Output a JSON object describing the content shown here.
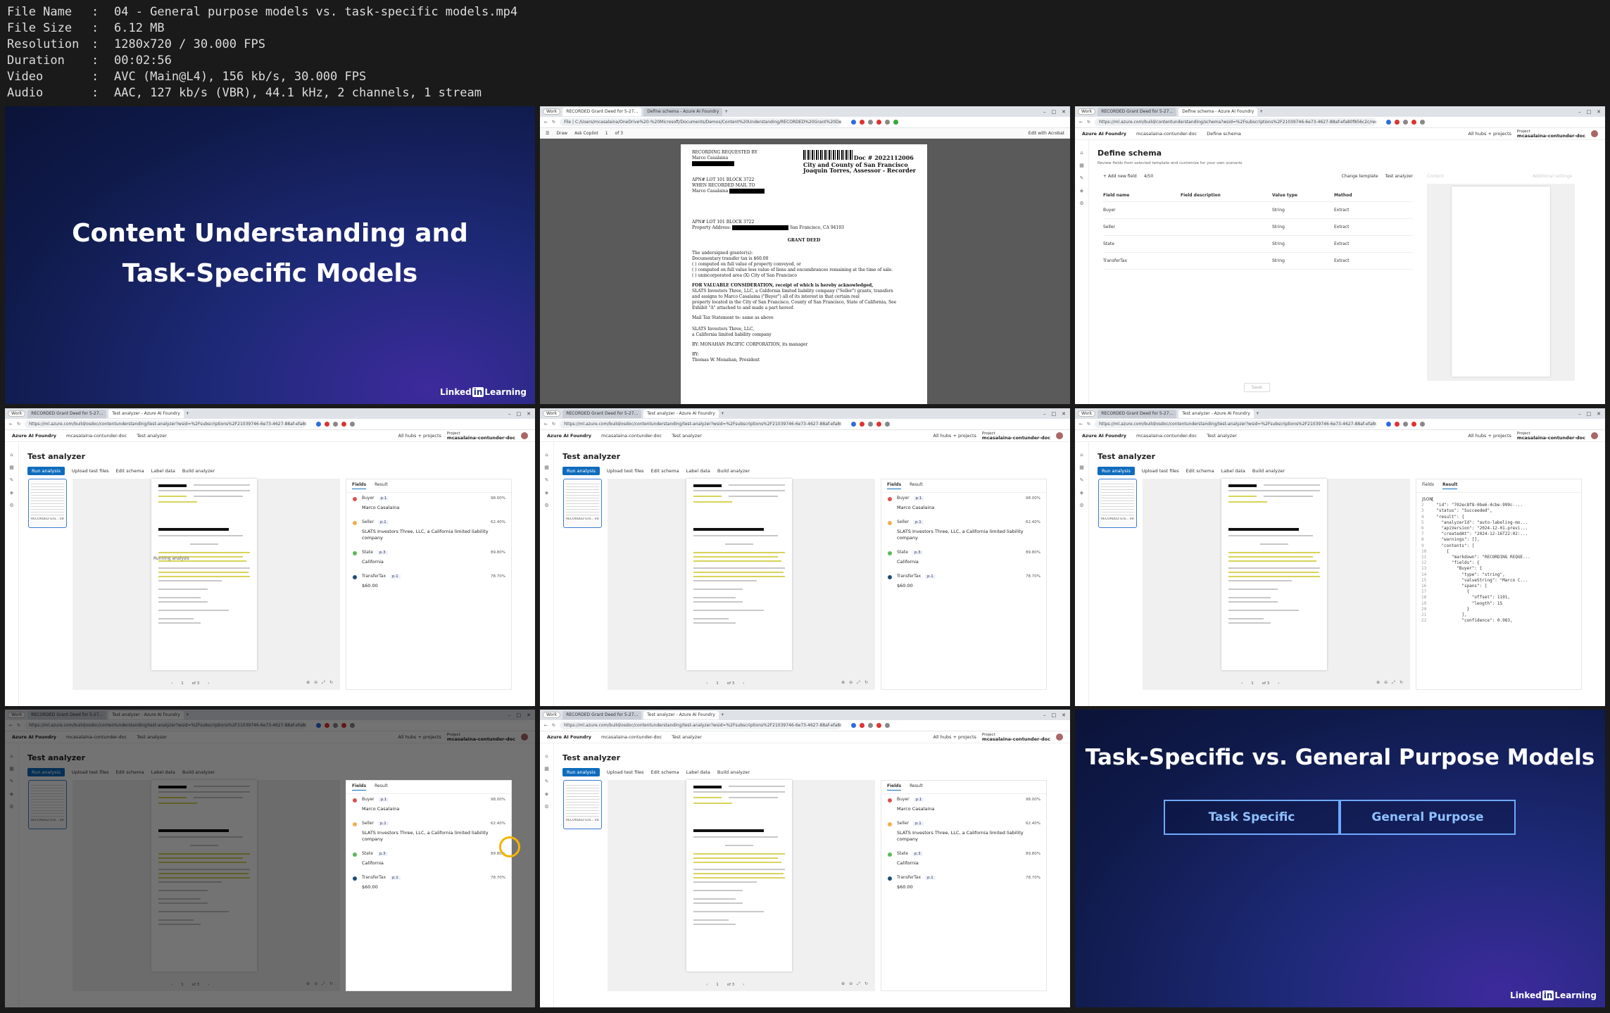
{
  "meta": [
    {
      "key": "File Name",
      "value": "04 - General purpose models vs. task-specific models.mp4"
    },
    {
      "key": "File Size",
      "value": "6.12 MB"
    },
    {
      "key": "Resolution",
      "value": "1280x720 / 30.000 FPS"
    },
    {
      "key": "Duration",
      "value": "00:02:56"
    },
    {
      "key": "Video",
      "value": "AVC (Main@L4), 156 kb/s, 30.000 FPS"
    },
    {
      "key": "Audio",
      "value": "AAC, 127 kb/s (VBR), 44.1 kHz, 2 channels, 1 stream"
    }
  ],
  "slide1": {
    "line1": "Content Understanding and",
    "line2": "Task-Specific Models",
    "logo_a": "Linked",
    "logo_b": "in",
    "logo_c": "Learning"
  },
  "slide9": {
    "title": "Task-Specific vs. General Purpose Models",
    "box1": "Task Specific",
    "box2": "General Purpose",
    "logo_a": "Linked",
    "logo_b": "in",
    "logo_c": "Learning"
  },
  "browser": {
    "work": "Work",
    "tab_pdf": "RECORDED Grant Deed for 5-27...",
    "tab_schema": "Define schema - Azure AI Foundry",
    "tab_test": "Test analyzer - Azure AI Foundry",
    "url_app": "https://ml.azure.com/build/osdoc/contentunderstanding/test-analyzer?wsid=%2Fsubscriptions%2F21039746-6e73-4627-88af-efa80f856c2c%...",
    "url_schema": "https://ml.azure.com/build/contentunderstanding/schema?wsid=%2Fsubscriptions%2F21039746-6e73-4627-88af-efa80f856c2c/resourceGro...",
    "url_file": "File | C:/Users/mcasalaina/OneDrive%20-%20Microsoft/Documents/Demos/Content%20Understanding/RECORDED%20Grant%20Deed..."
  },
  "app": {
    "brand": "Azure AI Foundry",
    "crumb_project": "mcasalaina-contunder-doc",
    "crumb_test": "Test analyzer",
    "crumb_schema": "Define schema",
    "all_hubs": "All hubs + projects",
    "project_label": "Project",
    "project_name": "mcasalaina-contunder-doc",
    "test_title": "Test analyzer",
    "btn_run": "Run analysis",
    "btn_upload": "Upload test files",
    "btn_edit": "Edit schema",
    "btn_label": "Label data",
    "btn_build": "Build analyzer",
    "thumb_label": "RECORDED Gra... ed.pdf",
    "tab_fields": "Fields",
    "tab_result": "Result",
    "page_of": "of 3",
    "page_num": "1",
    "running": "Running analysis",
    "json_label": "JSON"
  },
  "fields": [
    {
      "name": "Buyer",
      "page": "p.1",
      "conf": "98.00%",
      "value": "Marco Casalaina",
      "color": "#d9534f"
    },
    {
      "name": "Seller",
      "page": "p.1",
      "conf": "62.40%",
      "value": "SLATS Investors Three, LLC, a California limited liability company",
      "color": "#f0ad4e"
    },
    {
      "name": "State",
      "page": "p.3",
      "conf": "89.80%",
      "value": "California",
      "color": "#5cb85c"
    },
    {
      "name": "TransferTax",
      "page": "p.1",
      "conf": "78.70%",
      "value": "$60.00",
      "color": "#1f4e79"
    }
  ],
  "schema": {
    "title": "Define schema",
    "subtitle": "Review fields from selected template and customize for your own scenario",
    "add_field": "+ Add new field",
    "count": "4/50",
    "change_template": "Change template",
    "test_analyzer": "Test analyzer",
    "content": "Content",
    "additional": "Additional settings",
    "col_name": "Field name",
    "col_desc": "Field description",
    "col_type": "Value type",
    "col_method": "Method",
    "rows": [
      {
        "name": "Buyer",
        "type": "String",
        "method": "Extract"
      },
      {
        "name": "Seller",
        "type": "String",
        "method": "Extract"
      },
      {
        "name": "State",
        "type": "String",
        "method": "Extract"
      },
      {
        "name": "TransferTax",
        "type": "String",
        "method": "Extract"
      }
    ],
    "save": "Save"
  },
  "pdf": {
    "draw": "Draw",
    "ask": "Ask Copilot",
    "page": "1",
    "of": "of 3",
    "edit_acrobat": "Edit with Acrobat",
    "recording": "RECORDING REQUESTED BY",
    "name": "Marco Casalaina",
    "doc_no": "Doc # 2022112006",
    "county": "City and County of San Francisco",
    "assessor": "Joaquin Torres, Assessor - Recorder",
    "apn": "APN# LOT 101 BLOCK 3722",
    "when": "WHEN RECORDED MAIL TO",
    "apn2": "APN# LOT 101 BLOCK 3722",
    "property": "Property Address:",
    "city": "San Francisco, CA 94103",
    "heading": "GRANT DEED",
    "grantor": "The undersigned grantor(s):",
    "transfer": "Documentary transfer tax is $60.00",
    "l1": "( ) computed on full value of property conveyed, or",
    "l2": "( ) computed on full value less value of liens and encumbrances remaining at the time of sale.",
    "l3": "( ) unincorporated area     (X) City of San Francisco",
    "valuable": "FOR VALUABLE CONSIDERATION, receipt of which is hereby acknowledged,",
    "v1": "SLATS Investors Three, LLC, a California limited liability company (\"Seller\") grants, transfers",
    "v2": "and assigns to Marco Casalaina (\"Buyer\") all of its interest in that certain real",
    "v3": "property located in the City of San Francisco, County of San Francisco, State of California, See",
    "v4": "Exhibit \"A\" attached to and made a part hereof.",
    "mail": "Mail Tax Statement to: same as above",
    "s1": "SLATS Investors Three, LLC,",
    "s2": "a California limited liability company",
    "s3": "BY: MONAHAN PACIFIC CORPORATION, its manager",
    "s4": "BY:",
    "s5": "Thomas W. Monahan, President"
  },
  "json_lines": [
    "{",
    "  \"id\": \"702ec8f8-0be6-4cbe-999c-...",
    "  \"status\": \"Succeeded\",",
    "  \"result\": {",
    "    \"analyzerId\": \"auto-labeling-mo...",
    "    \"apiVersion\": \"2024-12-01-previ...",
    "    \"createdAt\": \"2024-12-16T22:02:...",
    "    \"warnings\": [],",
    "    \"contents\": [",
    "      {",
    "        \"markdown\": \"RECORDING REQUE...",
    "        \"fields\": {",
    "          \"Buyer\": {",
    "            \"type\": \"string\",",
    "            \"valueString\": \"Marco C...",
    "            \"spans\": [",
    "              {",
    "                \"offset\": 1191,",
    "                \"length\": 15",
    "              }",
    "            ],",
    "            \"confidence\": 0.983,"
  ]
}
